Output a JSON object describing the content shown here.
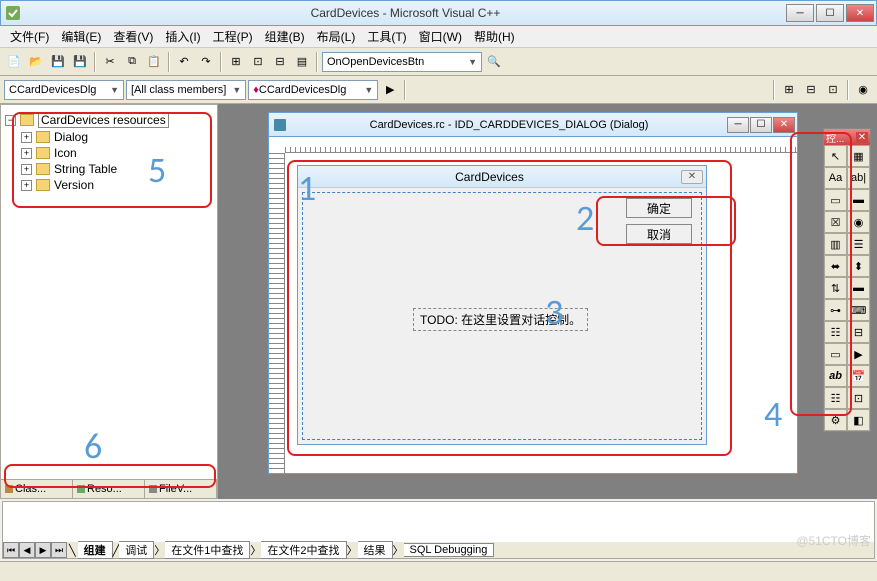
{
  "window": {
    "title": "CardDevices - Microsoft Visual C++"
  },
  "menu": {
    "file": "文件(F)",
    "edit": "编辑(E)",
    "view": "查看(V)",
    "insert": "插入(I)",
    "project": "工程(P)",
    "build": "组建(B)",
    "layout": "布局(L)",
    "tools": "工具(T)",
    "window": "窗口(W)",
    "help": "帮助(H)"
  },
  "toolbar2": {
    "combo_func": "OnOpenDevicesBtn"
  },
  "wizbar": {
    "class_combo": "CCardDevicesDlg",
    "filter_combo": "[All class members]",
    "member_combo": "CCardDevicesDlg"
  },
  "tree": {
    "root": "CardDevices resources",
    "items": [
      "Dialog",
      "Icon",
      "String Table",
      "Version"
    ]
  },
  "sidebar_tabs": {
    "class": "Clas...",
    "resource": "Reso...",
    "file": "FileV..."
  },
  "child": {
    "title": "CardDevices.rc - IDD_CARDDEVICES_DIALOG (Dialog)"
  },
  "dialog": {
    "title": "CardDevices",
    "ok": "确定",
    "cancel": "取消",
    "todo": "TODO: 在这里设置对话控制。"
  },
  "toolbox": {
    "title": "控..."
  },
  "output_tabs": {
    "build": "组建",
    "debug": "调试",
    "find1": "在文件1中查找",
    "find2": "在文件2中查找",
    "results": "结果",
    "sql": "SQL Debugging"
  },
  "annotations": {
    "a1": "1",
    "a2": "2",
    "a3": "3",
    "a4": "4",
    "a5": "5",
    "a6": "6"
  },
  "watermark": "@51CTO博客"
}
